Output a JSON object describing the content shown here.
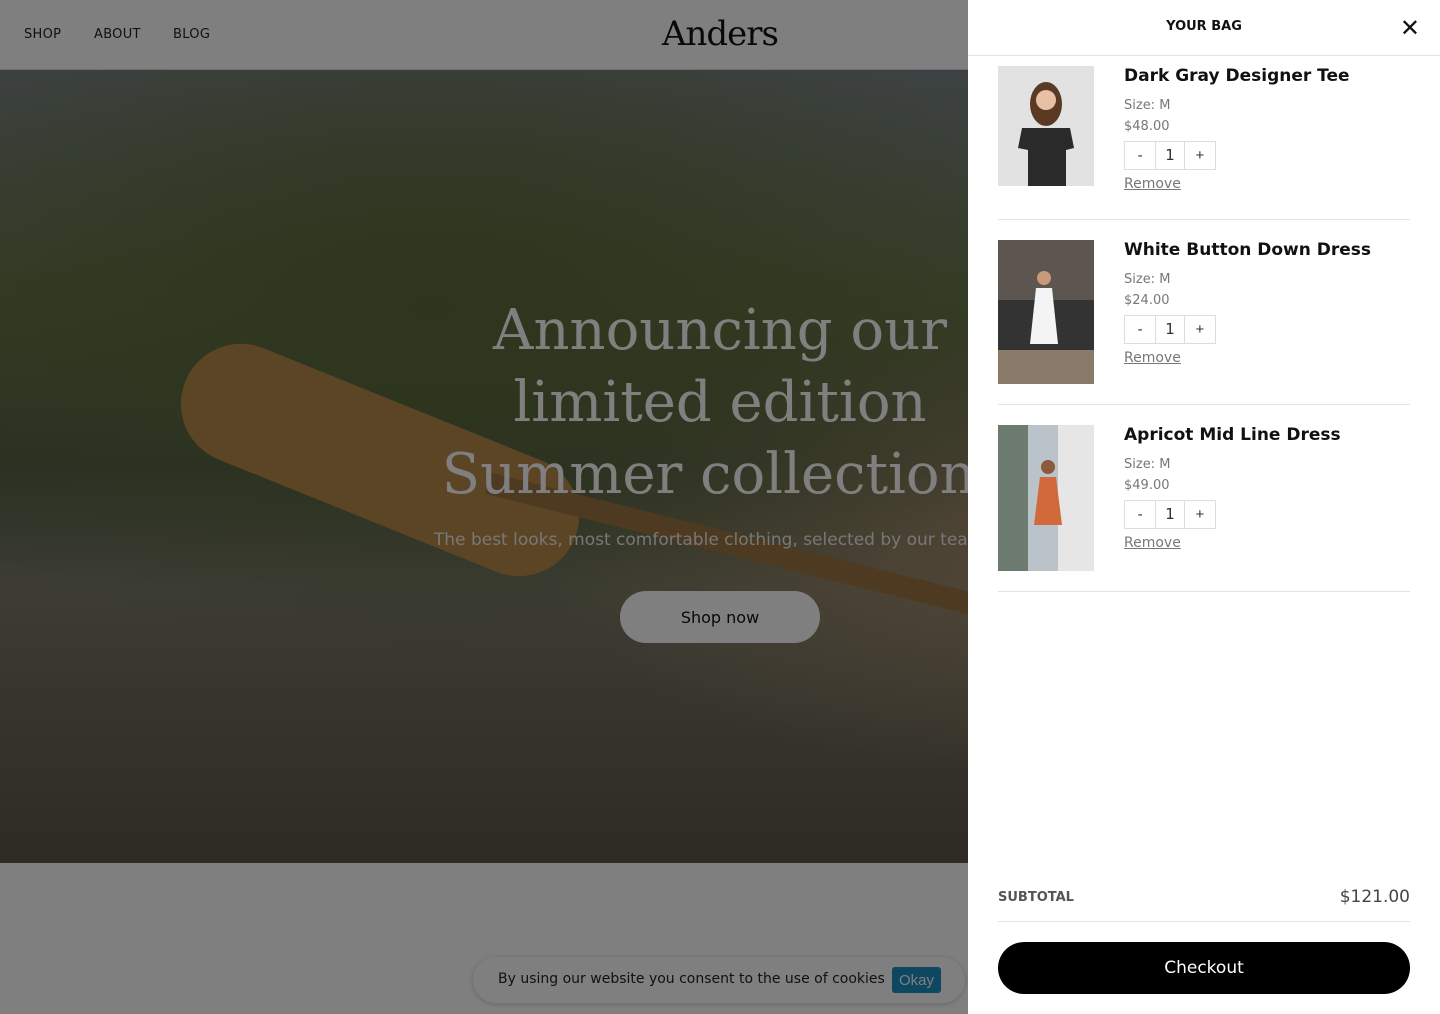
{
  "nav": {
    "items": [
      "SHOP",
      "ABOUT",
      "BLOG"
    ],
    "logo": "Anders"
  },
  "hero": {
    "title": "Announcing our limited edition Summer collection!",
    "subtitle": "The best looks, most comfortable clothing, selected by our team of",
    "cta": "Shop now"
  },
  "cookie": {
    "text": "By using our website you consent to the use of cookies",
    "button": "Okay",
    "button_color": "#1a8fc0"
  },
  "bag": {
    "title": "YOUR BAG",
    "close_icon": "close-icon",
    "items": [
      {
        "name": "Dark Gray Designer Tee",
        "size": "Size: M",
        "price": "$48.00",
        "qty": "1",
        "remove": "Remove"
      },
      {
        "name": "White Button Down Dress",
        "size": "Size: M",
        "price": "$24.00",
        "qty": "1",
        "remove": "Remove"
      },
      {
        "name": "Apricot Mid Line Dress",
        "size": "Size: M",
        "price": "$49.00",
        "qty": "1",
        "remove": "Remove"
      }
    ],
    "minus": "-",
    "plus": "+",
    "subtotal_label": "SUBTOTAL",
    "subtotal": "$121.00",
    "checkout": "Checkout"
  }
}
